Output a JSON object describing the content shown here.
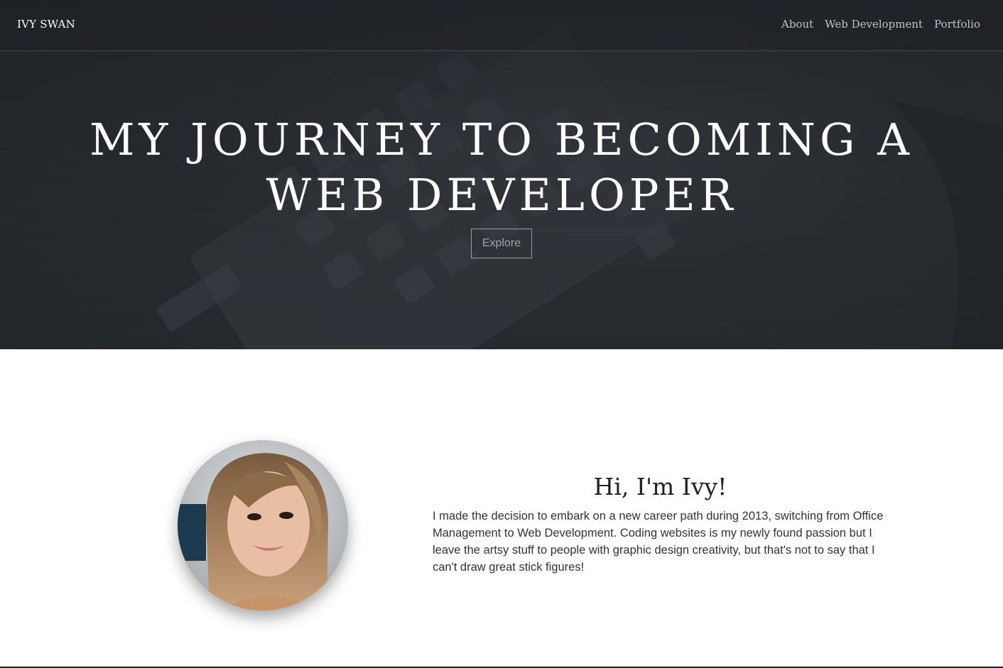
{
  "navbar": {
    "brand": "IVY SWAN",
    "links": [
      {
        "label": "About"
      },
      {
        "label": "Web Development"
      },
      {
        "label": "Portfolio"
      }
    ]
  },
  "hero": {
    "title": "MY JOURNEY TO BECOMING A WEB DEVELOPER",
    "button_label": "Explore",
    "background_image": "keyboard-photo"
  },
  "about": {
    "avatar_image": "profile-photo",
    "heading": "Hi, I'm Ivy!",
    "text": "I made the decision to embark on a new career path during 2013, switching from Office Management to Web Development. Coding websites is my newly found passion but I leave the artsy stuff to people with graphic design creativity, but that's not to say that I can't draw great stick figures!"
  },
  "colors": {
    "hero_bg": "#2c3034",
    "nav_text": "#bfc3c8",
    "heading_text": "#222222",
    "body_text": "#333333"
  }
}
